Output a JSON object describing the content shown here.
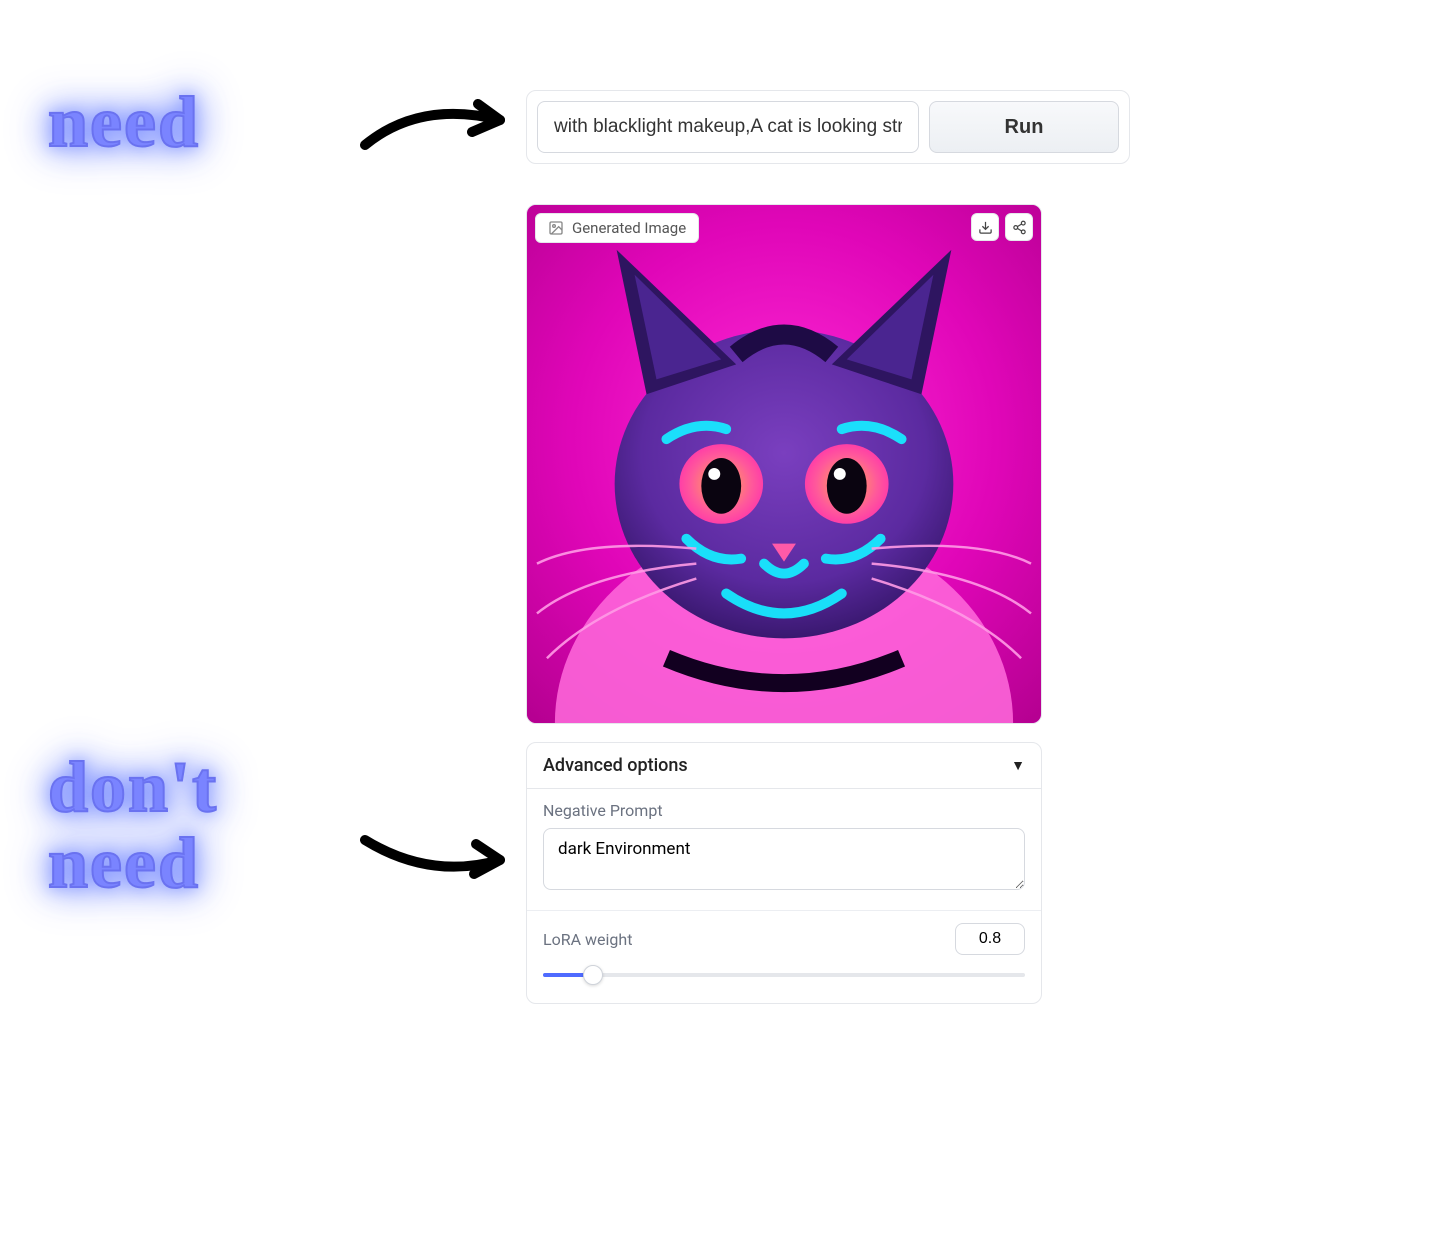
{
  "annotations": {
    "need": "need",
    "dont_need": "don't\nneed"
  },
  "prompt": {
    "value": "with blacklight makeup,A cat is looking straig",
    "run_label": "Run"
  },
  "image_card": {
    "label": "Generated Image"
  },
  "advanced": {
    "title": "Advanced options",
    "negative_label": "Negative Prompt",
    "negative_value": "dark Environment",
    "lora_label": "LoRA weight",
    "lora_value": "0.8"
  }
}
